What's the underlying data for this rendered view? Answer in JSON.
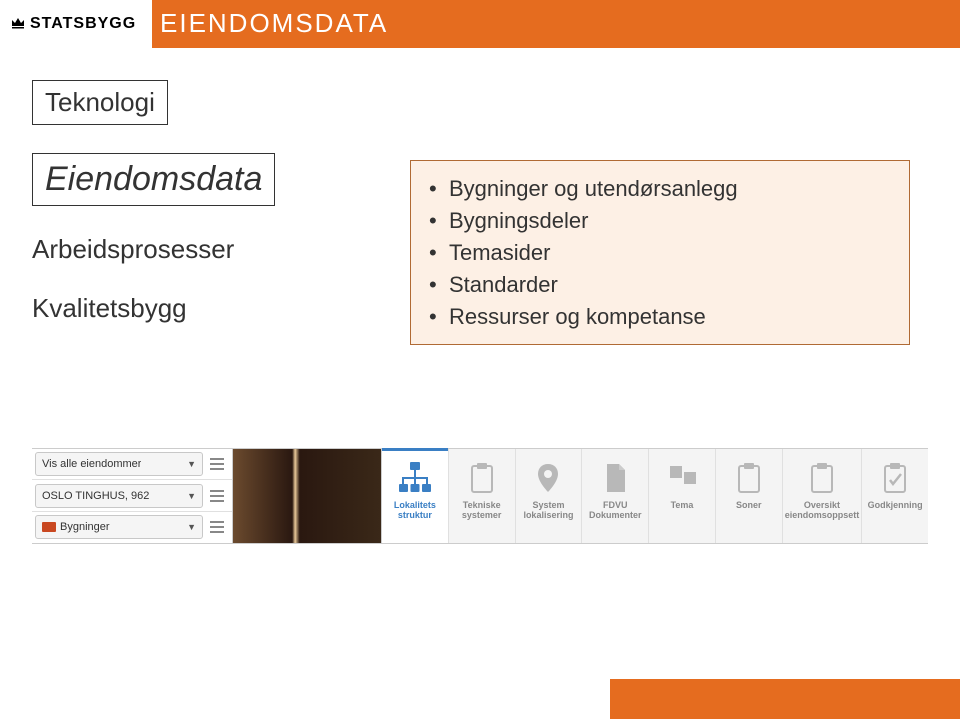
{
  "header": {
    "logo_text": "STATSBYGG",
    "title": "EIENDOMSDATA"
  },
  "left_boxes": {
    "teknologi": "Teknologi",
    "eiendomsdata": "Eiendomsdata",
    "arbeidsprosesser": "Arbeidsprosesser",
    "kvalitetsbygg": "Kvalitetsbygg"
  },
  "bullets": [
    "Bygninger og utendørsanlegg",
    "Bygningsdeler",
    "Temasider",
    "Standarder",
    "Ressurser og kompetanse"
  ],
  "toolbar": {
    "dropdowns": [
      {
        "label": "Vis alle eiendommer"
      },
      {
        "label": "OSLO TINGHUS, 962"
      },
      {
        "label": "Bygninger",
        "folder": true
      }
    ],
    "tabs": [
      {
        "label": "Lokalitets struktur",
        "active": true,
        "icon": "org"
      },
      {
        "label": "Tekniske systemer",
        "active": false,
        "icon": "clipboard"
      },
      {
        "label": "System lokalisering",
        "active": false,
        "icon": "pin"
      },
      {
        "label": "FDVU Dokumenter",
        "active": false,
        "icon": "doc"
      },
      {
        "label": "Tema",
        "active": false,
        "icon": "squares"
      },
      {
        "label": "Soner",
        "active": false,
        "icon": "clipboard"
      },
      {
        "label": "Oversikt eiendomsoppsett",
        "active": false,
        "icon": "clipboard"
      },
      {
        "label": "Godkjenning",
        "active": false,
        "icon": "check"
      }
    ]
  }
}
